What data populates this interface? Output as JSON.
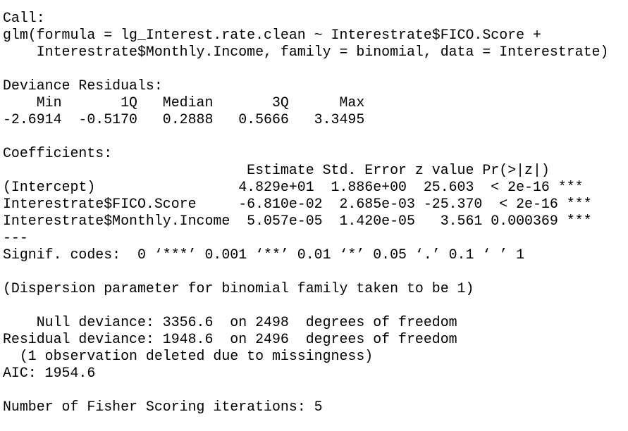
{
  "console": {
    "call_header": "Call:",
    "call_line1": "glm(formula = lg_Interest.rate.clean ~ Interestrate$FICO.Score +",
    "call_line2": "    Interestrate$Monthly.Income, family = binomial, data = Interestrate)",
    "deviance_header": "Deviance Residuals:",
    "deviance_columns": "    Min       1Q   Median       3Q      Max  ",
    "deviance_values": "-2.6914  -0.5170   0.2888   0.5666   3.3495  ",
    "coef_header": "Coefficients:",
    "coef_columns": "                             Estimate Std. Error z value Pr(>|z|)    ",
    "coef_rows": [
      "(Intercept)                 4.829e+01  1.886e+00  25.603  < 2e-16 ***",
      "Interestrate$FICO.Score     -6.810e-02  2.685e-03 -25.370  < 2e-16 ***",
      "Interestrate$Monthly.Income  5.057e-05  1.420e-05   3.561 0.000369 ***"
    ],
    "separator": "---",
    "signif_codes": "Signif. codes:  0 ‘***’ 0.001 ‘**’ 0.01 ‘*’ 0.05 ‘.’ 0.1 ‘ ’ 1",
    "dispersion": "(Dispersion parameter for binomial family taken to be 1)",
    "null_deviance": "    Null deviance: 3356.6  on 2498  degrees of freedom",
    "residual_deviance": "Residual deviance: 1948.6  on 2496  degrees of freedom",
    "missingness": "  (1 observation deleted due to missingness)",
    "aic": "AIC: 1954.6",
    "fisher": "Number of Fisher Scoring iterations: 5"
  }
}
